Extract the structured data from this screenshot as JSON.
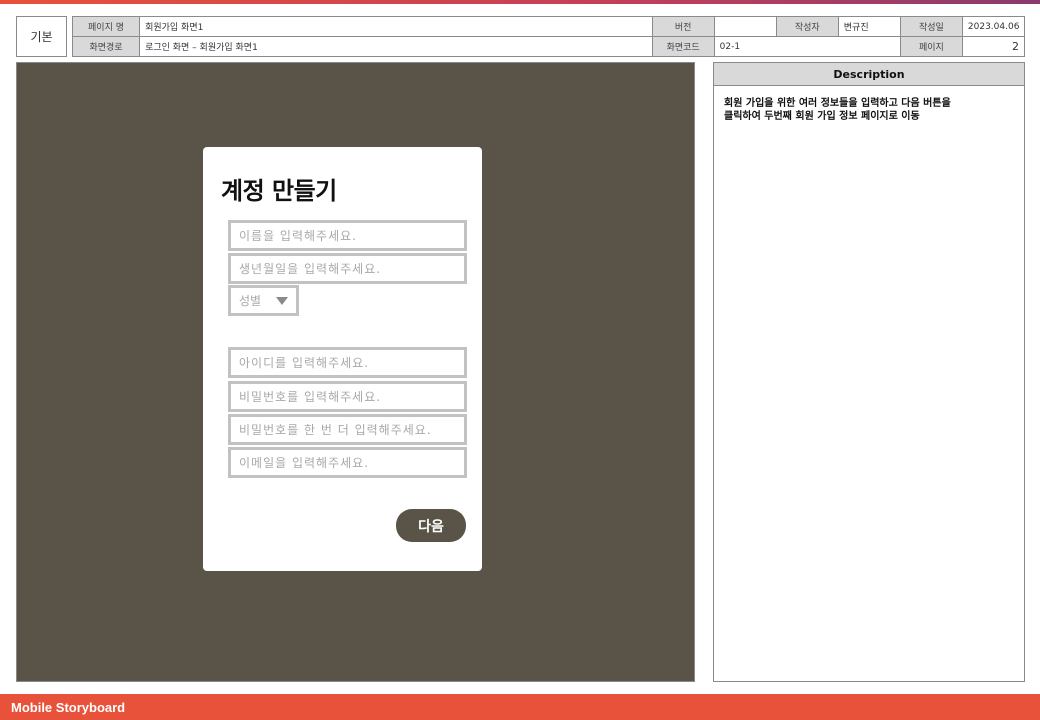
{
  "header": {
    "kind": "기본",
    "page_name_label": "페이지 명",
    "page_name": "회원가입 화면1",
    "version_label": "버전",
    "version": "",
    "author_label": "작성자",
    "author": "변규진",
    "date_label": "작성일",
    "date": "2023.04.06",
    "path_label": "화면경로",
    "path": "로그인 화면 – 회원가입 화면1",
    "code_label": "화면코드",
    "code": "02-1",
    "page_label": "페이지",
    "page": "2"
  },
  "screen": {
    "title": "계정 만들기",
    "name_placeholder": "이름을 입력해주세요.",
    "birth_placeholder": "생년월일을 입력해주세요.",
    "gender_placeholder": "성별",
    "id_placeholder": "아이디를 입력해주세요.",
    "password_placeholder": "비밀번호를 입력해주세요.",
    "password_confirm_placeholder": "비밀번호를 한 번 더 입력해주세요.",
    "email_placeholder": "이메일을 입력해주세요.",
    "next_label": "다음"
  },
  "description": {
    "heading": "Description",
    "text_line1": "회원 가입을 위한 여러 정보들을 입력하고 다음 버튼을",
    "text_line2": "클릭하여 두번째 회원 가입 정보 페이지로 이동"
  },
  "footer": {
    "label": "Mobile Storyboard"
  },
  "colors": {
    "accent": "#e8523a",
    "canvas_bg": "#5a5347",
    "button_bg": "#5a5347"
  },
  "icons": {
    "gender_dropdown": "caret-down-icon"
  }
}
